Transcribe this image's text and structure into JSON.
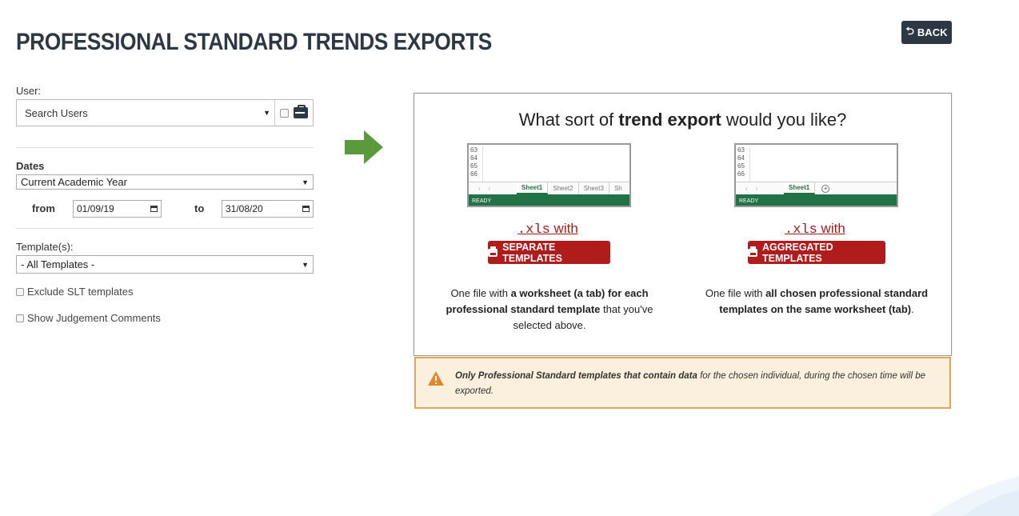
{
  "header": {
    "title": "PROFESSIONAL STANDARD TRENDS EXPORTS",
    "back_label": "BACK"
  },
  "form": {
    "user_label": "User:",
    "user_select_value": "Search Users",
    "dates_label": "Dates",
    "dates_select_value": "Current Academic Year",
    "from_label": "from",
    "from_value": "01/09/19",
    "to_label": "to",
    "to_value": "31/08/20",
    "templates_label": "Template(s):",
    "templates_select_value": "- All Templates -",
    "exclude_slt_label": "Exclude SLT templates",
    "show_comments_label": "Show Judgement Comments"
  },
  "panel": {
    "question_prefix": "What sort of ",
    "question_bold": "trend export",
    "question_suffix": " would you like?",
    "options": [
      {
        "xls_mono": ".xls",
        "xls_text": " with",
        "button_label": "SEPARATE TEMPLATES",
        "desc_1": "One file with ",
        "desc_2": "a worksheet (a tab) for each professional standard template",
        "desc_3": " that you've selected above.",
        "sheet_rows": [
          "63",
          "64",
          "65",
          "66"
        ],
        "sheet_tabs": [
          "Sheet1",
          "Sheet2",
          "Sheet3",
          "Sh"
        ],
        "status": "READY"
      },
      {
        "xls_mono": ".xls",
        "xls_text": " with",
        "button_label": "AGGREGATED TEMPLATES",
        "desc_1": "One file with ",
        "desc_2": "all chosen professional standard templates on the same worksheet (tab)",
        "desc_3": ".",
        "sheet_rows": [
          "63",
          "64",
          "65",
          "66"
        ],
        "sheet_tabs": [
          "Sheet1"
        ],
        "status": "READY"
      }
    ]
  },
  "warning": {
    "bold": "Only Professional Standard templates that contain data",
    "rest": " for the chosen individual, during the chosen time will be exported."
  },
  "colors": {
    "navy": "#2d3845",
    "red": "#b01c1c",
    "green_arrow": "#5a9a3c",
    "excel_green": "#217346",
    "warning_bg": "#fbefdd",
    "warning_border": "#e2a659"
  }
}
